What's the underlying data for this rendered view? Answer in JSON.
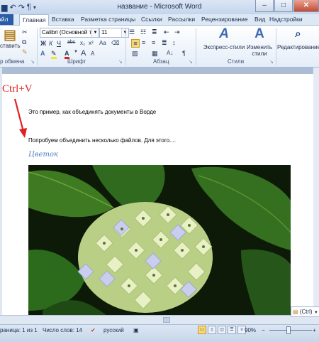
{
  "window": {
    "title": "название - Microsoft Word",
    "controls": {
      "minimize": "–",
      "maximize": "□",
      "close": "✕"
    }
  },
  "quick_access": {
    "save_icon": "save-icon",
    "undo_icon": "undo-icon",
    "redo_icon": "redo-icon",
    "paragraph_mark": "¶",
    "customize_icon": "dropdown-icon"
  },
  "ribbon_tabs": [
    "айл",
    "Главная",
    "Вставка",
    "Разметка страницы",
    "Ссылки",
    "Рассылки",
    "Рецензирование",
    "Вид",
    "Надстройки"
  ],
  "active_tab": "Главная",
  "ribbon": {
    "clipboard": {
      "paste_label": "ставить",
      "group_label": "р обмена"
    },
    "font": {
      "font_name": "Calibri (Основной те",
      "font_size": "11",
      "bold": "Ж",
      "italic": "К",
      "underline": "Ч",
      "strike": "abc",
      "subscript": "x₂",
      "superscript": "x²",
      "grow": "A",
      "shrink": "A",
      "change_case": "Aa",
      "font_color": "A",
      "group_label": "Шрифт"
    },
    "paragraph": {
      "pilcrow": "¶",
      "sort": "A↓",
      "group_label": "Абзац"
    },
    "styles": {
      "express_label": "Экспресс-стили",
      "change_label_1": "Изменить",
      "change_label_2": "стили",
      "group_label": "Стили"
    },
    "editing": {
      "label": "Редактирование"
    }
  },
  "document": {
    "line1": "Это пример, как объединять документы в Ворде",
    "line2": "Попробуем объединить несколько файлов. Для этого....",
    "caption": "Цветок",
    "image": "hydrangea-flower-photo"
  },
  "annotation": {
    "text": "Ctrl+V",
    "color": "#e02020"
  },
  "paste_options": {
    "label": "(Ctrl)",
    "icon": "clipboard-icon"
  },
  "status_bar": {
    "page": "раница: 1 из 1",
    "words": "Число слов: 14",
    "language": "русский",
    "zoom": "90%",
    "zoom_minus": "−",
    "zoom_plus": "+"
  },
  "colors": {
    "caption": "#4f81bd",
    "file_tab": "#2a5ca8",
    "leaf_green": "#2f6a1e",
    "flower": "#dfe8b0"
  }
}
